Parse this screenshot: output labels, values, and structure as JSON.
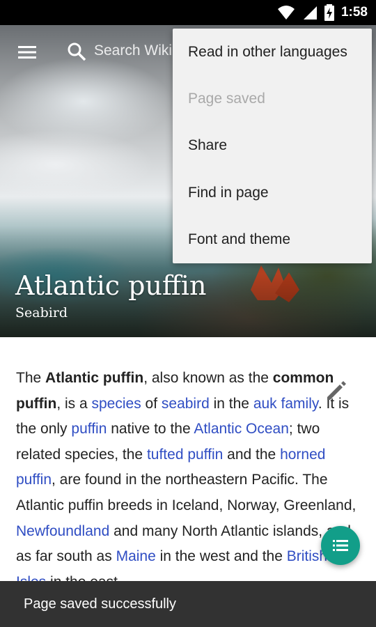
{
  "status_bar": {
    "time": "1:58"
  },
  "toolbar": {
    "search_placeholder": "Search Wikipedia"
  },
  "overflow_menu": {
    "items": [
      {
        "label": "Read in other languages",
        "enabled": true
      },
      {
        "label": "Page saved",
        "enabled": false
      },
      {
        "label": "Share",
        "enabled": true
      },
      {
        "label": "Find in page",
        "enabled": true
      },
      {
        "label": "Font and theme",
        "enabled": true
      }
    ]
  },
  "article": {
    "title": "Atlantic puffin",
    "subtitle": "Seabird",
    "p1": {
      "t1": "The ",
      "b1": "Atlantic puffin",
      "t2": ", also known as the ",
      "b2": "common puffin",
      "t3": ", is a ",
      "l1": "species",
      "t4": " of ",
      "l2": "seabird",
      "t5": " in the ",
      "l3": "auk family",
      "t6": ". It is the only ",
      "l4": "puffin",
      "t7": " native to the ",
      "l5": "Atlantic Ocean",
      "t8": "; two related species, the ",
      "l6": "tufted puffin",
      "t9": " and the ",
      "l7": "horned puffin",
      "t10": ", are found in the northeastern Pacific. The Atlantic puffin breeds in Iceland, Norway, Greenland, ",
      "l8": "Newfoundland",
      "t11": " and many North Atlantic islands, and as far south as ",
      "l9": "Maine",
      "t12": " in the west and the ",
      "l10": "British Isles",
      "t13": " in the east."
    }
  },
  "snackbar": {
    "message": "Page saved successfully"
  },
  "colors": {
    "link": "#2f4dc3",
    "fab": "#129e89",
    "snackbar": "#323232",
    "menu_bg": "#f1f1f1"
  },
  "icons": [
    "wifi-icon",
    "signal-icon",
    "battery-charging-icon",
    "menu-icon",
    "search-icon",
    "edit-pencil-icon",
    "table-of-contents-icon"
  ]
}
